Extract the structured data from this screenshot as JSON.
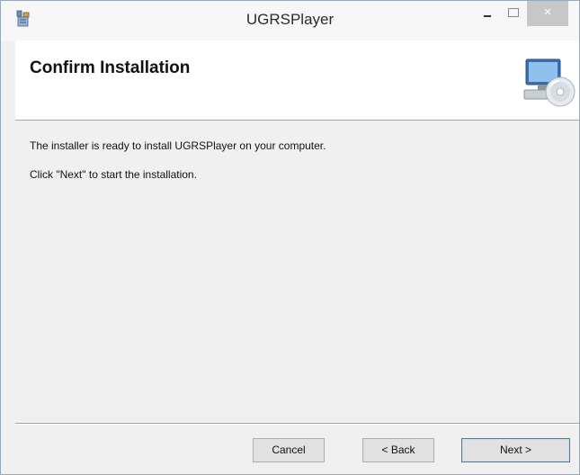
{
  "window": {
    "title": "UGRSPlayer",
    "close_glyph": "×"
  },
  "header": {
    "title": "Confirm Installation",
    "icon": "computer-cd-icon"
  },
  "body": {
    "line1": "The installer is ready to install UGRSPlayer on your computer.",
    "line2": "Click \"Next\" to start the installation."
  },
  "buttons": {
    "cancel": "Cancel",
    "back": "< Back",
    "next": "Next >"
  },
  "colors": {
    "close_button": "#c7c7c7",
    "default_button_border": "#3c7fb1",
    "header_bg": "#ffffff",
    "body_bg": "#f0f0f0"
  }
}
